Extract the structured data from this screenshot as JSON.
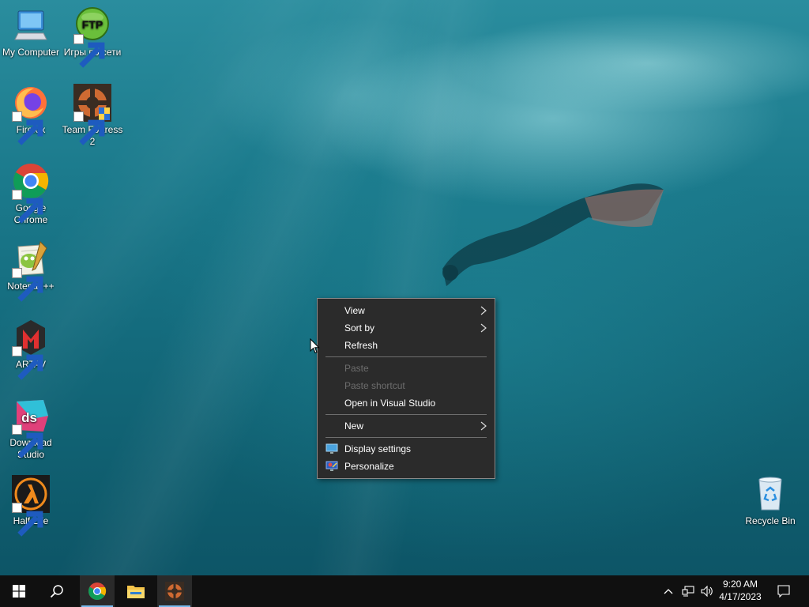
{
  "desktop": {
    "icons": [
      {
        "label": "My Computer",
        "icon": "computer-icon"
      },
      {
        "label": "Игры по сети",
        "icon": "ftp-icon"
      },
      {
        "label": "Firefox",
        "icon": "firefox-icon"
      },
      {
        "label": "Team Fortress 2",
        "icon": "team-fortress-2-icon"
      },
      {
        "label": "Google Chrome",
        "icon": "chrome-icon"
      },
      {
        "label": "Notepad++",
        "icon": "notepad-plus-plus-icon"
      },
      {
        "label": "ARTAV",
        "icon": "artav-icon"
      },
      {
        "label": "Download Studio",
        "icon": "download-studio-icon"
      },
      {
        "label": "Half-Life",
        "icon": "half-life-icon"
      },
      {
        "label": "Recycle Bin",
        "icon": "recycle-bin-icon"
      }
    ],
    "ftp_badge": "FTP",
    "ds_badge": "ds"
  },
  "context_menu": {
    "items": [
      {
        "label": "View",
        "submenu": true,
        "disabled": false
      },
      {
        "label": "Sort by",
        "submenu": true,
        "disabled": false
      },
      {
        "label": "Refresh",
        "submenu": false,
        "disabled": false
      },
      {
        "label": "Paste",
        "submenu": false,
        "disabled": true
      },
      {
        "label": "Paste shortcut",
        "submenu": false,
        "disabled": true
      },
      {
        "label": "Open in Visual Studio",
        "submenu": false,
        "disabled": false
      },
      {
        "label": "New",
        "submenu": true,
        "disabled": false
      },
      {
        "label": "Display settings",
        "submenu": false,
        "disabled": false,
        "icon": "display-settings-icon"
      },
      {
        "label": "Personalize",
        "submenu": false,
        "disabled": false,
        "icon": "personalize-icon"
      }
    ]
  },
  "taskbar": {
    "pinned": [
      "start-icon",
      "search-icon",
      "chrome-icon",
      "file-explorer-icon",
      "team-fortress-2-icon"
    ],
    "clock_time": "9:20 AM",
    "clock_date": "4/17/2023",
    "accent_color": "#76b9ed"
  }
}
